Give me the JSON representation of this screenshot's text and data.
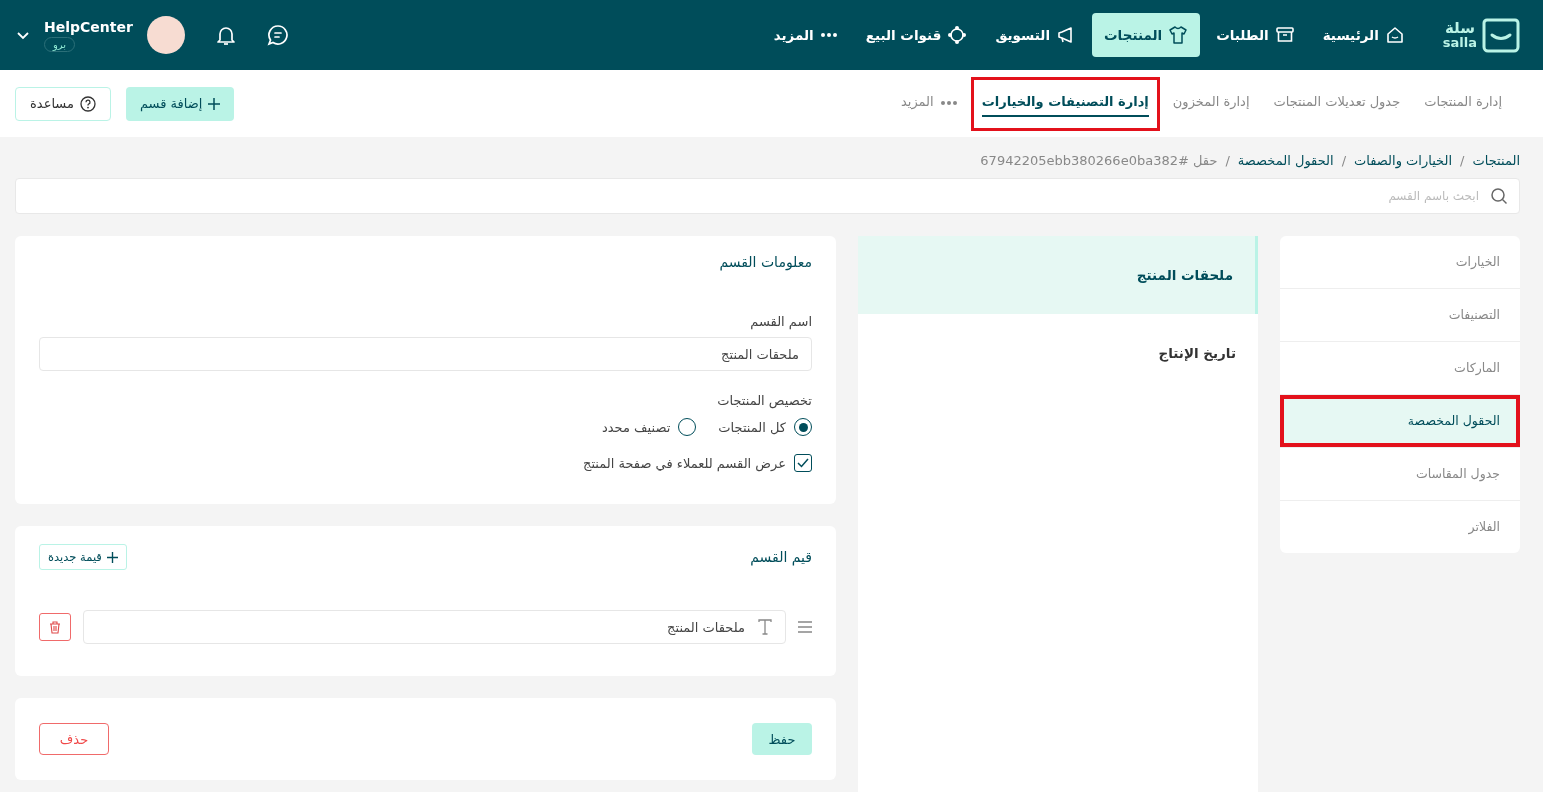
{
  "topbar": {
    "logo": {
      "arabic": "سلة",
      "latin": "salla"
    },
    "nav": [
      {
        "label": "الرئيسية",
        "selected": false
      },
      {
        "label": "الطلبات",
        "selected": false
      },
      {
        "label": "المنتجات",
        "selected": true
      },
      {
        "label": "التسويق",
        "selected": false
      },
      {
        "label": "قنوات البيع",
        "selected": false
      },
      {
        "label": "المزيد",
        "selected": false
      }
    ],
    "user": {
      "name": "HelpCenter",
      "plan": "برو"
    }
  },
  "subnav": {
    "tabs": [
      {
        "label": "إدارة المنتجات",
        "kind": "link",
        "selected": false,
        "highlighted": false
      },
      {
        "label": "جدول تعديلات المنتجات",
        "kind": "link",
        "selected": false,
        "highlighted": false
      },
      {
        "label": "إدارة المخزون",
        "kind": "link",
        "selected": false,
        "highlighted": false
      },
      {
        "label": "إدارة التصنيفات والخيارات",
        "kind": "link",
        "selected": true,
        "highlighted": true
      },
      {
        "label": "المزيد",
        "kind": "more",
        "selected": false,
        "highlighted": false
      }
    ],
    "add_button": "إضافة قسم",
    "help_button": "مساعدة"
  },
  "breadcrumb": {
    "separator": "/",
    "items": [
      {
        "label": "المنتجات",
        "current": false
      },
      {
        "label": "الخيارات والصفات",
        "current": false
      },
      {
        "label": "الحقول المخصصة",
        "current": false
      },
      {
        "label": "حقل #67942205ebb380266e0ba382",
        "current": true
      }
    ]
  },
  "search": {
    "placeholder": "ابحث باسم القسم"
  },
  "sidebar": {
    "items": [
      {
        "label": "الخيارات",
        "selected": false,
        "highlighted": false
      },
      {
        "label": "التصنيفات",
        "selected": false,
        "highlighted": false
      },
      {
        "label": "الماركات",
        "selected": false,
        "highlighted": false
      },
      {
        "label": "الحقول المخصصة",
        "selected": true,
        "highlighted": true
      },
      {
        "label": "جدول المقاسات",
        "selected": false,
        "highlighted": false
      },
      {
        "label": "الفلاتر",
        "selected": false,
        "highlighted": false
      }
    ]
  },
  "sections": [
    {
      "label": "ملحقات المنتج",
      "selected": true
    },
    {
      "label": "تاريخ الإنتاج",
      "selected": false
    }
  ],
  "info_card": {
    "title": "معلومات القسم",
    "name_label": "اسم القسم",
    "name_value": "ملحقات المنتج",
    "scope_label": "تخصيص المنتجات",
    "scope_options": [
      {
        "label": "كل المنتجات",
        "selected": true
      },
      {
        "label": "تصنيف محدد",
        "selected": false
      }
    ],
    "show_option": {
      "label": "عرض القسم للعملاء في صفحة المنتج",
      "checked": true
    }
  },
  "values_card": {
    "title": "قيم القسم",
    "add_button": "قيمة جديدة",
    "values": [
      {
        "value": "ملحقات المنتج"
      }
    ]
  },
  "actions": {
    "save": "حفظ",
    "delete": "حذف"
  }
}
